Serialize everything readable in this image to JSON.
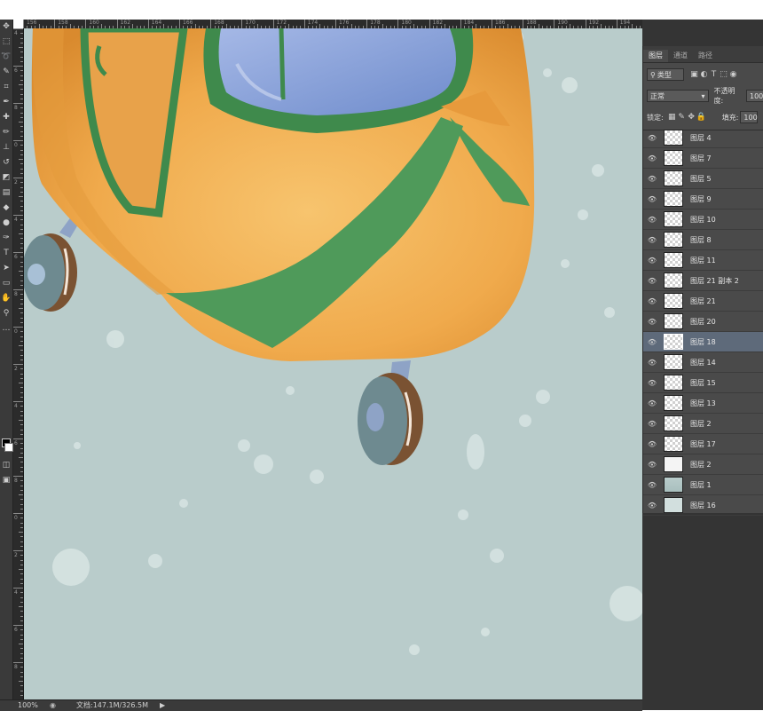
{
  "ruler_h": {
    "labels": [
      "156",
      "158",
      "160",
      "162",
      "164",
      "166",
      "168",
      "170",
      "172",
      "174",
      "176",
      "178",
      "180",
      "182",
      "184",
      "186",
      "188",
      "190",
      "192",
      "194"
    ]
  },
  "ruler_v": {
    "labels": [
      "4",
      "6",
      "8",
      "0",
      "2",
      "4",
      "6",
      "8",
      "0",
      "2",
      "4",
      "6",
      "8",
      "0",
      "2",
      "4",
      "6",
      "8"
    ]
  },
  "toolbar": {
    "tools": [
      {
        "name": "move-tool-icon",
        "glyph": "✥"
      },
      {
        "name": "marquee-tool-icon",
        "glyph": "⬚"
      },
      {
        "name": "lasso-tool-icon",
        "glyph": "➰"
      },
      {
        "name": "quick-select-icon",
        "glyph": "✎"
      },
      {
        "name": "crop-tool-icon",
        "glyph": "⌗"
      },
      {
        "name": "eyedropper-tool-icon",
        "glyph": "✒"
      },
      {
        "name": "healing-brush-icon",
        "glyph": "✚"
      },
      {
        "name": "brush-tool-icon",
        "glyph": "✏"
      },
      {
        "name": "clone-stamp-icon",
        "glyph": "⊥"
      },
      {
        "name": "history-brush-icon",
        "glyph": "↺"
      },
      {
        "name": "eraser-tool-icon",
        "glyph": "◩"
      },
      {
        "name": "gradient-tool-icon",
        "glyph": "▤"
      },
      {
        "name": "blur-tool-icon",
        "glyph": "◆"
      },
      {
        "name": "dodge-tool-icon",
        "glyph": "●"
      },
      {
        "name": "pen-tool-icon",
        "glyph": "✑"
      },
      {
        "name": "type-tool-icon",
        "glyph": "T"
      },
      {
        "name": "path-select-icon",
        "glyph": "➤"
      },
      {
        "name": "shape-tool-icon",
        "glyph": "▭"
      },
      {
        "name": "hand-tool-icon",
        "glyph": "✋"
      },
      {
        "name": "zoom-tool-icon",
        "glyph": "⚲"
      },
      {
        "name": "more-tools-icon",
        "glyph": "…"
      }
    ],
    "extra_icons": [
      {
        "name": "quick-mask-icon",
        "glyph": "◫"
      },
      {
        "name": "screen-mode-icon",
        "glyph": "▣"
      }
    ]
  },
  "status": {
    "zoom": "100%",
    "doc_info": "文档:147.1M/326.5M",
    "arrow_glyph": "▶"
  },
  "panel": {
    "tabs": [
      "图层",
      "通道",
      "路径"
    ],
    "filter": {
      "label": "类型",
      "icon_glyph": "⚲"
    },
    "filter_icons": [
      "▣",
      "◐",
      "T",
      "⬚",
      "◉"
    ],
    "blend_mode": "正常",
    "opacity_label": "不透明度:",
    "opacity_value": "100",
    "lock_label": "锁定:",
    "lock_icons": [
      "▦",
      "✎",
      "✥",
      "🔒"
    ],
    "fill_label": "填充:",
    "fill_value": "100"
  },
  "layers": [
    {
      "name": "图层 4",
      "thumb": "checker"
    },
    {
      "name": "图层 7",
      "thumb": "checker"
    },
    {
      "name": "图层 5",
      "thumb": "checker"
    },
    {
      "name": "图层 9",
      "thumb": "checker"
    },
    {
      "name": "图层 10",
      "thumb": "checker"
    },
    {
      "name": "图层 8",
      "thumb": "checker"
    },
    {
      "name": "图层 11",
      "thumb": "checker"
    },
    {
      "name": "图层 21 副本 2",
      "thumb": "checker"
    },
    {
      "name": "图层 21",
      "thumb": "checker"
    },
    {
      "name": "图层 20",
      "thumb": "checker"
    },
    {
      "name": "图层 18",
      "thumb": "checker",
      "selected": true
    },
    {
      "name": "图层 14",
      "thumb": "checker"
    },
    {
      "name": "图层 15",
      "thumb": "checker"
    },
    {
      "name": "图层 13",
      "thumb": "checker"
    },
    {
      "name": "图层 2",
      "thumb": "checker"
    },
    {
      "name": "图层 17",
      "thumb": "checker"
    },
    {
      "name": "图层 2",
      "thumb": "white"
    },
    {
      "name": "图层 1",
      "thumb": "scene"
    },
    {
      "name": "图层 16",
      "thumb": "solid"
    }
  ],
  "colors": {
    "canvas_bg": "#b9cccb",
    "body_orange": "#f0a94a",
    "stripe_green": "#4f9a5a",
    "window_blue": "#7f9bd6",
    "wheel_tire": "#7a5a3a",
    "wheel_hub": "#6e8a90",
    "strut": "#8ea3c6",
    "selected_row": "#5e6a7a"
  }
}
